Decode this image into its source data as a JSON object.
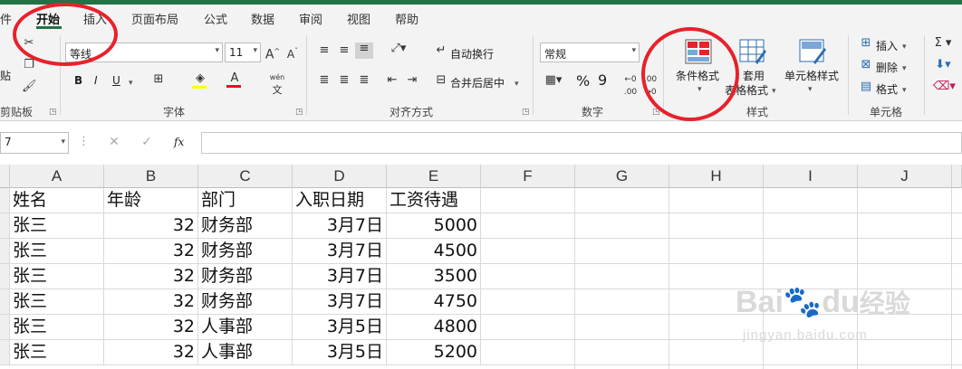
{
  "tabs": [
    "件",
    "开始",
    "插入",
    "页面布局",
    "公式",
    "数据",
    "审阅",
    "视图",
    "帮助"
  ],
  "clipboard": {
    "paste_label": "贴",
    "group_label": "剪贴板"
  },
  "font": {
    "name": "等线",
    "size": "11",
    "group_label": "字体",
    "bold": "B",
    "italic": "I",
    "underline": "U",
    "phonetic": "wén"
  },
  "alignment": {
    "wrap_text": "自动换行",
    "merge_center": "合并后居中",
    "group_label": "对齐方式"
  },
  "number": {
    "format": "常规",
    "percent": "%",
    "comma": "9",
    "group_label": "数字"
  },
  "styles": {
    "conditional_format": "条件格式",
    "format_as_table_1": "套用",
    "format_as_table_2": "表格格式",
    "cell_styles": "单元格样式",
    "group_label": "样式"
  },
  "cells_group": {
    "insert": "插入",
    "delete": "删除",
    "format": "格式",
    "group_label": "单元格"
  },
  "formula_bar": {
    "namebox": "7",
    "fx": "fx",
    "value": ""
  },
  "columns": [
    "A",
    "B",
    "C",
    "D",
    "E",
    "F",
    "G",
    "H",
    "I",
    "J"
  ],
  "rows": [
    [
      "姓名",
      "年龄",
      "部门",
      "入职日期",
      "工资待遇"
    ],
    [
      "张三",
      "32",
      "财务部",
      "3月7日",
      "5000"
    ],
    [
      "张三",
      "32",
      "财务部",
      "3月7日",
      "4500"
    ],
    [
      "张三",
      "32",
      "财务部",
      "3月7日",
      "3500"
    ],
    [
      "张三",
      "32",
      "财务部",
      "3月7日",
      "4750"
    ],
    [
      "张三",
      "32",
      "人事部",
      "3月5日",
      "4800"
    ],
    [
      "张三",
      "32",
      "人事部",
      "3月5日",
      "5200"
    ]
  ],
  "watermark": {
    "brand": "Bai",
    "brand2": "du",
    "text": "经验",
    "url": "jingyan.baidu.com"
  },
  "colors": {
    "excel_green": "#217346",
    "annotation_red": "#e8212a"
  }
}
